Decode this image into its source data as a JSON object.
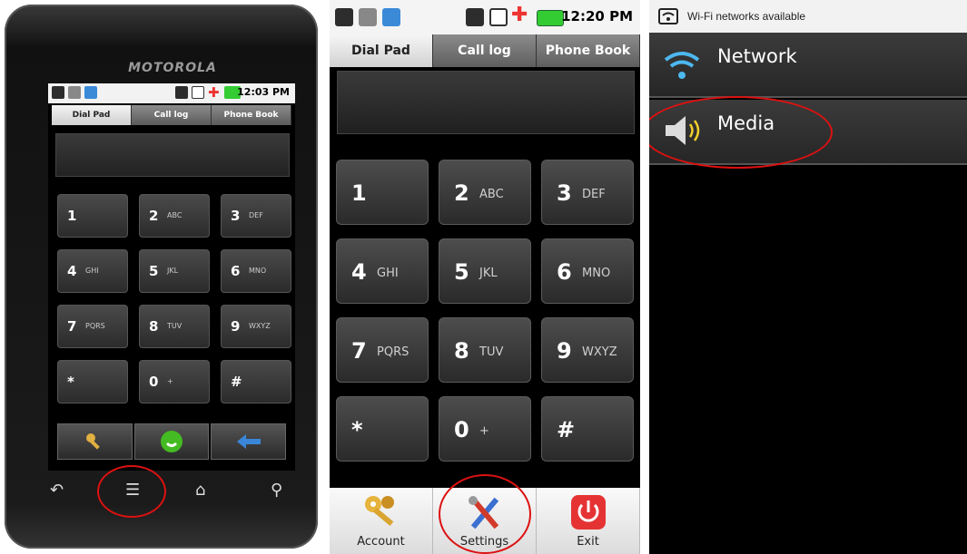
{
  "phone": {
    "brand": "MOTOROLA",
    "status_time": "12:03 PM",
    "tabs": [
      "Dial Pad",
      "Call log",
      "Phone Book"
    ],
    "keys": [
      {
        "digit": "1",
        "letters": ""
      },
      {
        "digit": "2",
        "letters": "ABC"
      },
      {
        "digit": "3",
        "letters": "DEF"
      },
      {
        "digit": "4",
        "letters": "GHI"
      },
      {
        "digit": "5",
        "letters": "JKL"
      },
      {
        "digit": "6",
        "letters": "MNO"
      },
      {
        "digit": "7",
        "letters": "PQRS"
      },
      {
        "digit": "8",
        "letters": "TUV"
      },
      {
        "digit": "9",
        "letters": "WXYZ"
      },
      {
        "digit": "*",
        "letters": ""
      },
      {
        "digit": "0",
        "letters": "+"
      },
      {
        "digit": "#",
        "letters": ""
      }
    ],
    "action_icons": [
      "key-icon",
      "call-icon",
      "backspace-icon"
    ],
    "nav_icons": [
      "back-icon",
      "menu-icon",
      "home-icon",
      "search-icon"
    ]
  },
  "dialer": {
    "status_time": "12:20 PM",
    "tabs": [
      "Dial Pad",
      "Call log",
      "Phone Book"
    ],
    "keys": [
      {
        "digit": "1",
        "letters": ""
      },
      {
        "digit": "2",
        "letters": "ABC"
      },
      {
        "digit": "3",
        "letters": "DEF"
      },
      {
        "digit": "4",
        "letters": "GHI"
      },
      {
        "digit": "5",
        "letters": "JKL"
      },
      {
        "digit": "6",
        "letters": "MNO"
      },
      {
        "digit": "7",
        "letters": "PQRS"
      },
      {
        "digit": "8",
        "letters": "TUV"
      },
      {
        "digit": "9",
        "letters": "WXYZ"
      },
      {
        "digit": "*",
        "letters": ""
      },
      {
        "digit": "0",
        "letters": "+"
      },
      {
        "digit": "#",
        "letters": ""
      }
    ],
    "menu": [
      {
        "label": "Account",
        "icon": "keys-icon"
      },
      {
        "label": "Settings",
        "icon": "tools-icon"
      },
      {
        "label": "Exit",
        "icon": "power-icon"
      }
    ]
  },
  "settings": {
    "notification": "Wi-Fi networks available",
    "items": [
      {
        "label": "Network",
        "icon": "wifi-icon"
      },
      {
        "label": "Media",
        "icon": "speaker-icon"
      }
    ]
  },
  "colors": {
    "highlight": "#dd1111",
    "accent_green": "#44bb22",
    "accent_red": "#e53333"
  }
}
